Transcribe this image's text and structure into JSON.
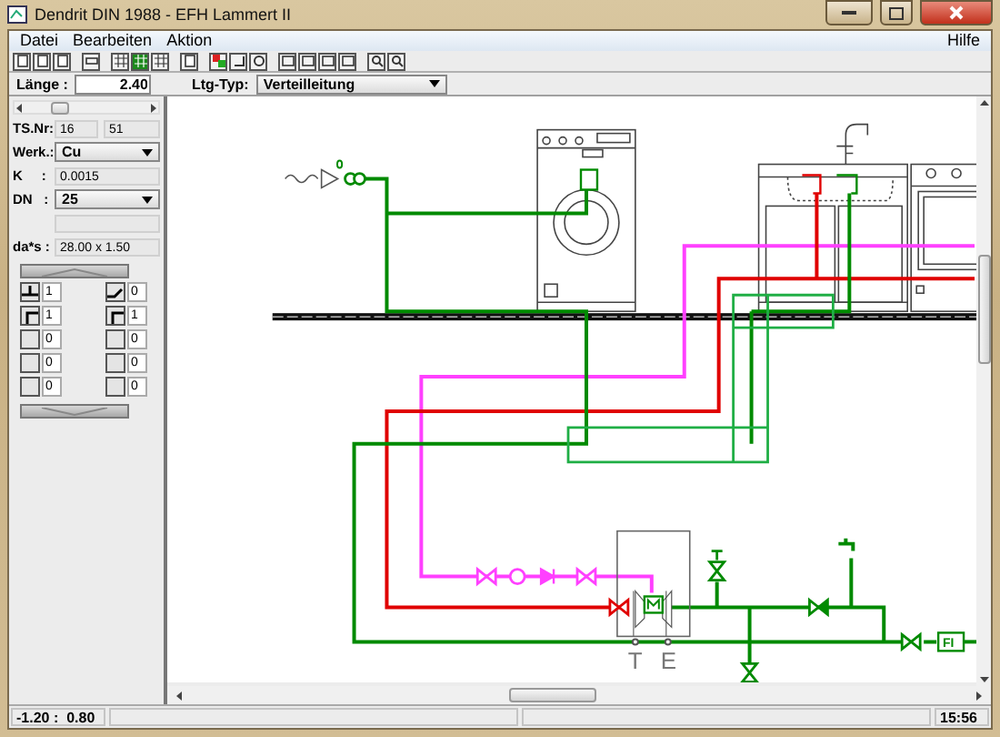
{
  "window": {
    "title": "Dendrit DIN 1988  - EFH Lammert II"
  },
  "menu": [
    {
      "label": "Datei"
    },
    {
      "label": "Bearbeiten"
    },
    {
      "label": "Aktion"
    }
  ],
  "help_menu": {
    "label": "Hilfe"
  },
  "toolbar": [
    [
      {
        "kind": "page",
        "selected": false
      },
      {
        "kind": "page",
        "selected": false
      },
      {
        "kind": "page",
        "selected": false
      }
    ],
    [
      {
        "kind": "ruler",
        "selected": false
      }
    ],
    [
      {
        "kind": "grid",
        "selected": false
      },
      {
        "kind": "grid",
        "selected": true
      },
      {
        "kind": "grid",
        "selected": false
      }
    ],
    [
      {
        "kind": "page",
        "selected": false
      }
    ],
    [
      {
        "kind": "color",
        "selected": false
      },
      {
        "kind": "corner",
        "selected": false
      },
      {
        "kind": "tool",
        "selected": false
      }
    ],
    [
      {
        "kind": "window",
        "selected": false
      },
      {
        "kind": "window",
        "selected": false
      },
      {
        "kind": "window",
        "selected": false
      },
      {
        "kind": "window",
        "selected": false
      }
    ],
    [
      {
        "kind": "zoom",
        "selected": false
      },
      {
        "kind": "zoom",
        "selected": false
      }
    ]
  ],
  "pipe_bar": {
    "length_label": "Länge :",
    "length_value": "2.40",
    "type_label": "Ltg-Typ:",
    "type_value": "Verteilleitung"
  },
  "panel": {
    "rows": [
      {
        "kind": "pair",
        "label": "TS.Nr:",
        "values": [
          "16",
          "51"
        ]
      },
      {
        "kind": "select",
        "label": "Werk.:",
        "value": "Cu"
      },
      {
        "kind": "text",
        "label": "K     :",
        "value": "0.0015"
      },
      {
        "kind": "select",
        "label": "DN   :",
        "value": "25"
      },
      {
        "kind": "blank"
      },
      {
        "kind": "text",
        "label": "da*s :",
        "value": "28.00 x 1.50"
      }
    ],
    "fittings": [
      {
        "left": {
          "kind": "tee",
          "value": "1"
        },
        "right": {
          "kind": "bend",
          "value": "0"
        }
      },
      {
        "left": {
          "kind": "elbow",
          "value": "1"
        },
        "right": {
          "kind": "elbow",
          "value": "1"
        }
      },
      {
        "left": {
          "kind": "none",
          "value": "0"
        },
        "right": {
          "kind": "none",
          "value": "0"
        }
      },
      {
        "left": {
          "kind": "none",
          "value": "0"
        },
        "right": {
          "kind": "none",
          "value": "0"
        }
      },
      {
        "left": {
          "kind": "none",
          "value": "0"
        },
        "right": {
          "kind": "none",
          "value": "0"
        }
      }
    ]
  },
  "drawing": {
    "heater_labels": [
      "T",
      "E"
    ],
    "meter_label": "FI"
  },
  "status_bar": {
    "position": "-1.20 :  0.80",
    "time": "15:56"
  }
}
